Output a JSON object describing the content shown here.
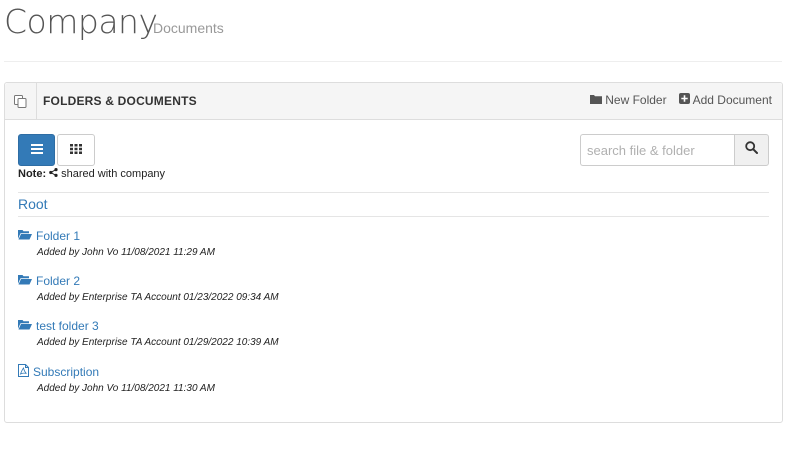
{
  "header": {
    "title": "Company",
    "subtitle": "Documents"
  },
  "panel": {
    "title": "FOLDERS & DOCUMENTS",
    "actions": {
      "new_folder": "New Folder",
      "add_document": "Add Document"
    }
  },
  "toolbar": {
    "view_modes": [
      "list",
      "grid"
    ],
    "active_view": "list"
  },
  "note": {
    "label": "Note:",
    "text": "shared with company"
  },
  "search": {
    "placeholder": "search file & folder",
    "value": ""
  },
  "breadcrumb": {
    "root": "Root"
  },
  "items": [
    {
      "type": "folder",
      "name": "Folder 1",
      "meta": "Added by John Vo 11/08/2021 11:29 AM",
      "icon": "folder-open-icon"
    },
    {
      "type": "folder",
      "name": "Folder 2",
      "meta": "Added by Enterprise TA Account 01/23/2022 09:34 AM",
      "icon": "folder-open-icon"
    },
    {
      "type": "folder",
      "name": "test folder 3",
      "meta": "Added by Enterprise TA Account 01/29/2022 10:39 AM",
      "icon": "folder-open-icon"
    },
    {
      "type": "pdf",
      "name": "Subscription",
      "meta": "Added by John Vo 11/08/2021 11:30 AM",
      "icon": "file-pdf-icon"
    }
  ],
  "colors": {
    "link": "#337ab7",
    "primary_button": "#337ab7",
    "panel_heading_bg": "#f5f5f5"
  }
}
